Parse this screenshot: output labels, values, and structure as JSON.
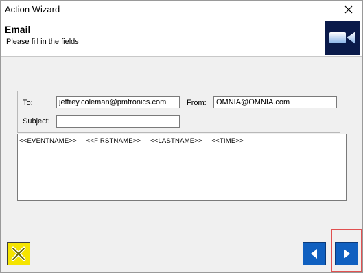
{
  "window": {
    "title": "Action Wizard",
    "close_icon": "close-icon"
  },
  "header": {
    "title": "Email",
    "subtitle": "Please fill in the fields",
    "icon": "video-camera-icon"
  },
  "form": {
    "to_label": "To:",
    "to_value": "jeffrey.coleman@pmtronics.com",
    "from_label": "From:",
    "from_value": "OMNIA@OMNIA.com",
    "subject_label": "Subject:",
    "subject_value": "",
    "body_value": "<<EVENTNAME>>  <<FIRSTNAME>>  <<LASTNAME>>  <<TIME>>"
  },
  "footer": {
    "cancel_icon": "cancel-x-icon",
    "back_icon": "arrow-left-icon",
    "next_icon": "arrow-right-icon"
  },
  "colors": {
    "cancel_button": "#f5e400",
    "nav_button": "#1060c0",
    "header_icon_bg": "#0a1a4a",
    "highlight": "#e05050"
  }
}
